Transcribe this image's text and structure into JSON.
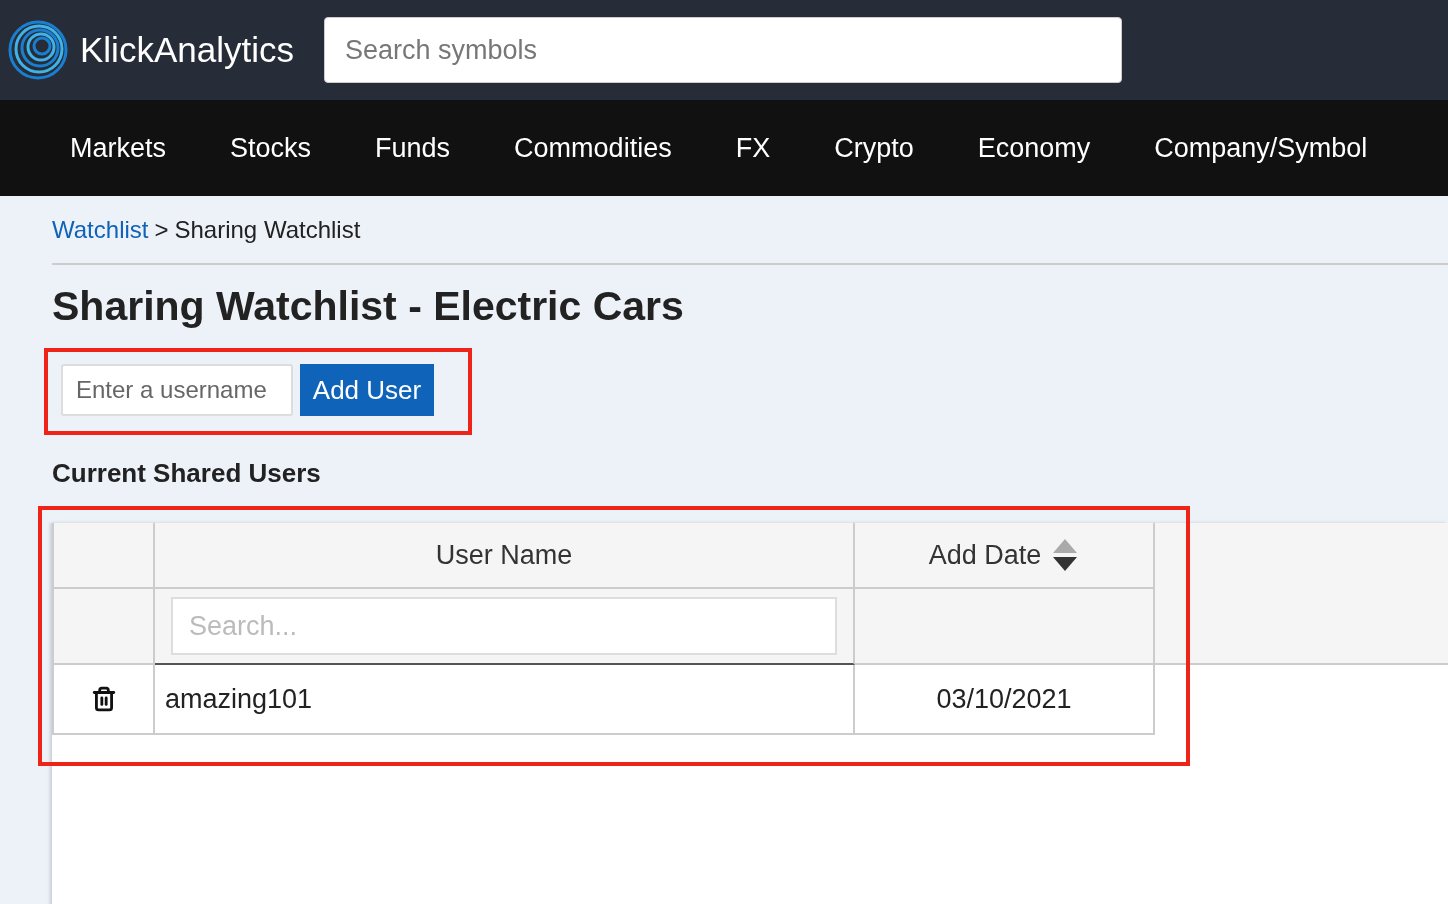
{
  "header": {
    "brand": "KlickAnalytics",
    "search": {
      "placeholder": "Search symbols"
    }
  },
  "nav": [
    {
      "label": "Markets"
    },
    {
      "label": "Stocks"
    },
    {
      "label": "Funds"
    },
    {
      "label": "Commodities"
    },
    {
      "label": "FX"
    },
    {
      "label": "Crypto"
    },
    {
      "label": "Economy"
    },
    {
      "label": "Company/Symbol"
    }
  ],
  "breadcrumb": {
    "link": "Watchlist",
    "separator": ">",
    "current": "Sharing Watchlist"
  },
  "title": "Sharing Watchlist - Electric Cars",
  "add_user": {
    "placeholder": "Enter a username",
    "button": "Add User"
  },
  "section_title": "Current Shared Users",
  "table": {
    "columns": [
      {
        "label": "User Name",
        "sortable": false
      },
      {
        "label": "Add Date",
        "sortable": true
      }
    ],
    "filter": {
      "placeholder": "Search..."
    },
    "rows": [
      {
        "user_name": "amazing101",
        "add_date": "03/10/2021"
      }
    ]
  }
}
